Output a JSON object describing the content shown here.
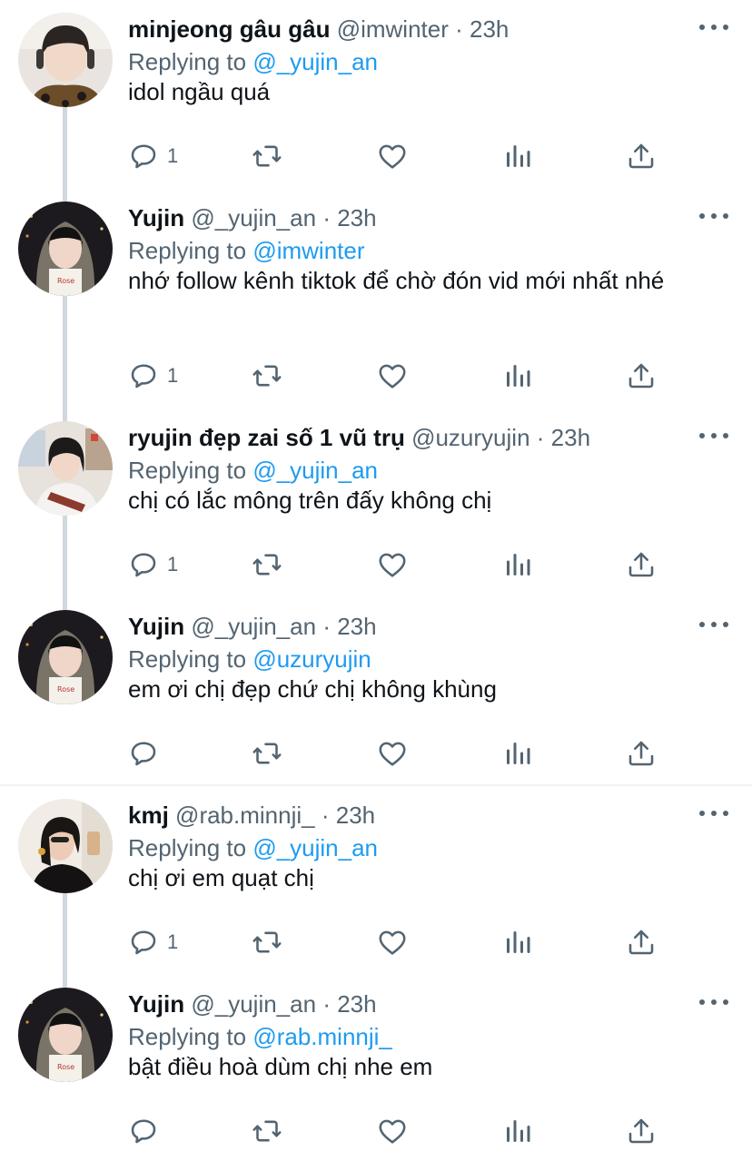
{
  "theme": {
    "accent": "#1d9bf0",
    "text": "#0f1419",
    "muted": "#536471",
    "thread_line": "#cfd9de"
  },
  "icons": {
    "reply": "speech-bubble-icon",
    "retweet": "retweet-icon",
    "like": "heart-icon",
    "stats": "bar-chart-icon",
    "share": "share-upload-icon",
    "more": "three-dots-icon"
  },
  "tweets": [
    {
      "name": "minjeong gâu gâu",
      "handle": "@imwinter",
      "dot": "·",
      "time": "23h",
      "replying_prefix": "Replying to",
      "replying_to": "@_yujin_an",
      "text": "idol ngầu quá",
      "reply_count": "1"
    },
    {
      "name": "Yujin",
      "handle": "@_yujin_an",
      "dot": "·",
      "time": "23h",
      "replying_prefix": "Replying to",
      "replying_to": "@imwinter",
      "text": "nhớ follow kênh tiktok để chờ đón vid mới nhất nhé",
      "reply_count": "1"
    },
    {
      "name": "ryujin đẹp zai số 1 vũ trụ",
      "handle": "@uzuryujin",
      "dot": "·",
      "time": "23h",
      "replying_prefix": "Replying to",
      "replying_to": "@_yujin_an",
      "text": "chị có lắc mông trên đấy không chị",
      "reply_count": "1"
    },
    {
      "name": "Yujin",
      "handle": "@_yujin_an",
      "dot": "·",
      "time": "23h",
      "replying_prefix": "Replying to",
      "replying_to": "@uzuryujin",
      "text": "em ơi chị đẹp chứ chị không khùng",
      "reply_count": ""
    },
    {
      "name": "kmj",
      "handle": "@rab.minnji_",
      "dot": "·",
      "time": "23h",
      "replying_prefix": "Replying to",
      "replying_to": "@_yujin_an",
      "text": "chị ơi em quạt chị",
      "reply_count": "1"
    },
    {
      "name": "Yujin",
      "handle": "@_yujin_an",
      "dot": "·",
      "time": "23h",
      "replying_prefix": "Replying to",
      "replying_to": "@rab.minnji_",
      "text": "bật điều hoà dùm chị nhe em",
      "reply_count": ""
    }
  ]
}
